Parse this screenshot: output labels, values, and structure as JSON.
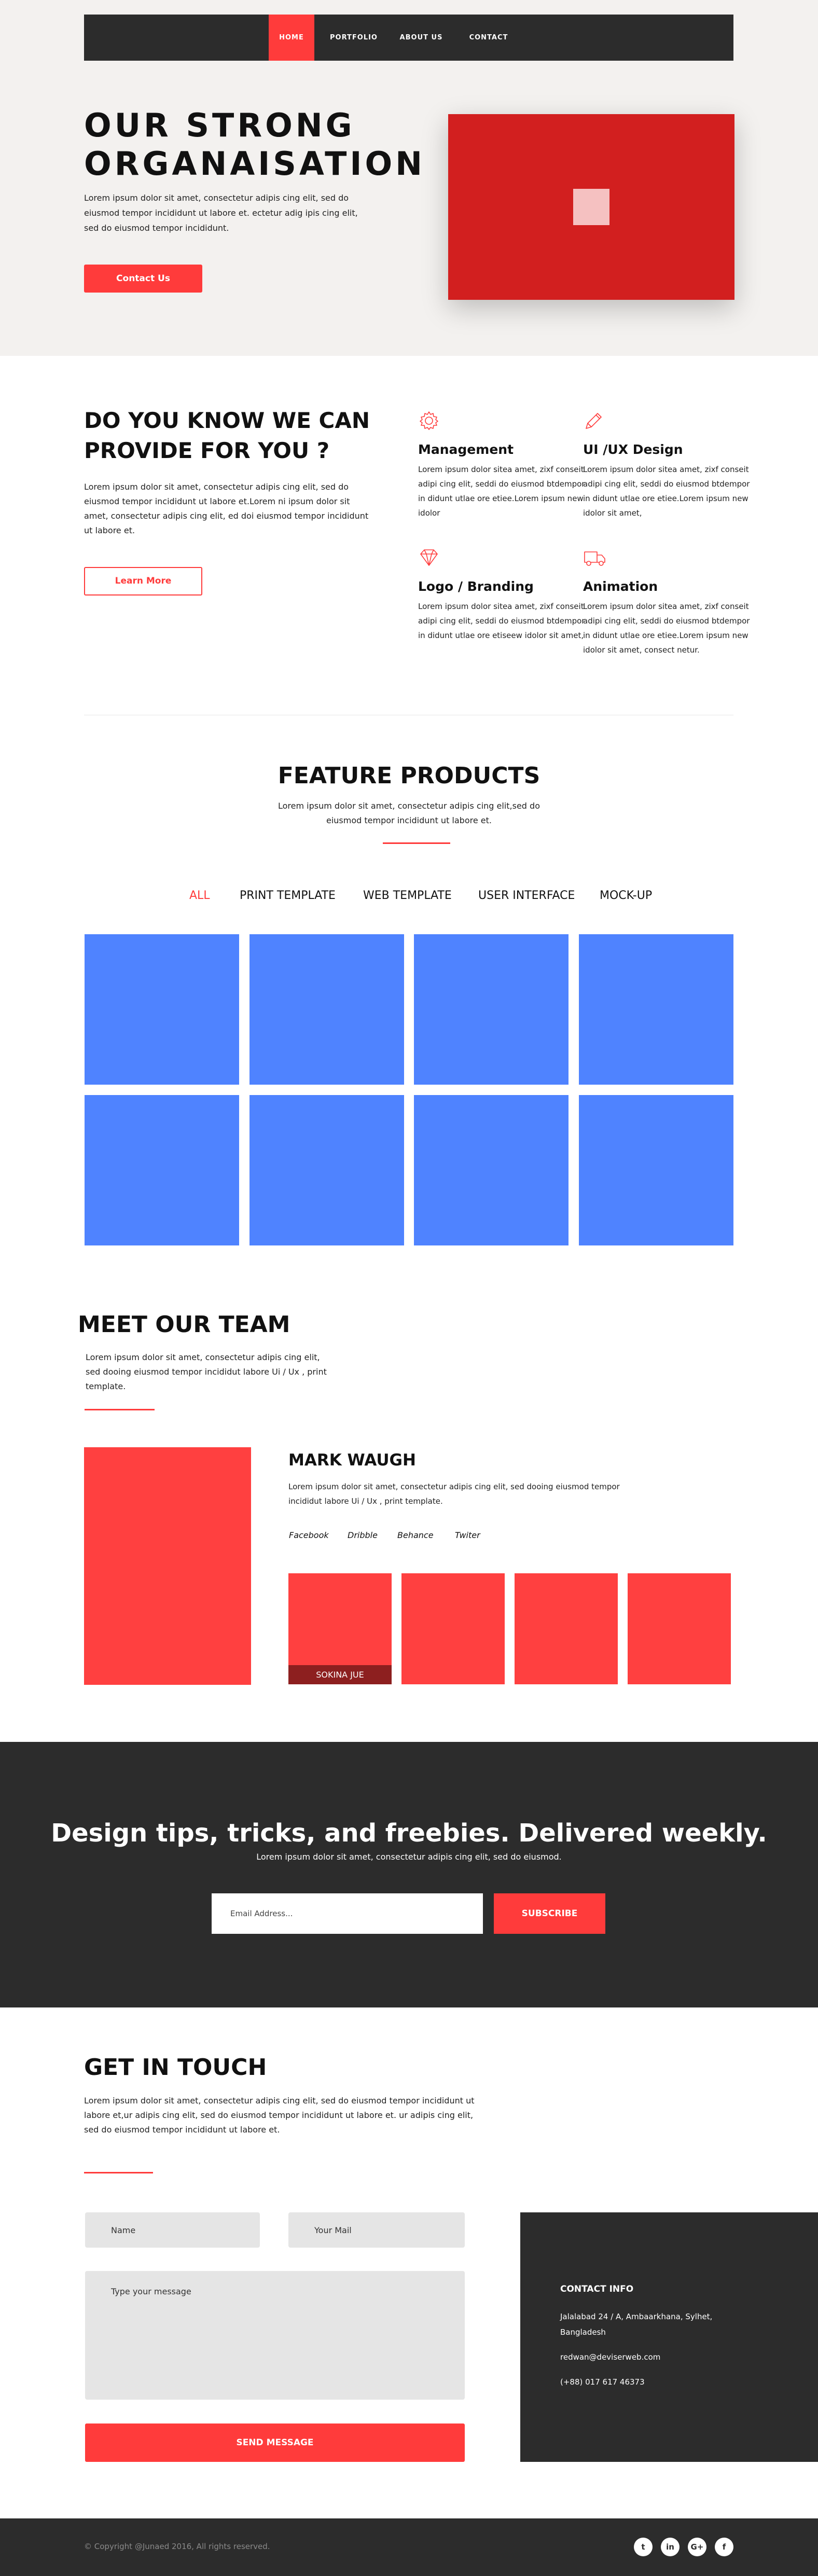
{
  "nav": {
    "items": [
      {
        "label": "HOME",
        "active": true
      },
      {
        "label": "PORTFOLIO",
        "active": false
      },
      {
        "label": "ABOUT US",
        "active": false
      },
      {
        "label": "CONTACT",
        "active": false
      }
    ]
  },
  "hero": {
    "title": "OUR STRONG ORGANAISATION",
    "text": "Lorem ipsum dolor sit amet, consectetur adipis cing elit, sed do eiusmod tempor incididunt  ut labore et. ectetur adig ipis cing elit, sed do eiusmod tempor incididunt.",
    "button": "Contact Us"
  },
  "provide": {
    "title": "DO YOU KNOW WE CAN PROVIDE FOR YOU ?",
    "text": "Lorem ipsum dolor sit amet, consectetur adipis cing elit, sed do eiusmod tempor incididunt ut labore et.Lorem ni ipsum dolor sit amet, consectetur adipis cing elit, ed doi eiusmod tempor incididunt ut labore et.",
    "button": "Learn More",
    "services": [
      {
        "icon": "gear-icon",
        "title": "Management",
        "text": "Lorem ipsum dolor sitea amet, zixf conseit  adipi cing elit, seddi do eiusmod btdempor in didunt utlae ore etiee.Lorem ipsum new idolor"
      },
      {
        "icon": "pencil-icon",
        "title": "UI /UX Design",
        "text": "Lorem ipsum dolor sitea amet, zixf conseit adipi cing elit, seddi do eiusmod btdempor in didunt utlae ore etiee.Lorem ipsum new idolor sit amet,"
      },
      {
        "icon": "diamond-icon",
        "title": "Logo / Branding",
        "text": "Lorem ipsum dolor sitea amet, zixf conseit  adipi cing elit, seddi do eiusmod btdempor in didunt utlae ore etiseew idolor sit amet,"
      },
      {
        "icon": "truck-icon",
        "title": "Animation",
        "text": "Lorem ipsum dolor sitea amet, zixf conseit adipi cing elit, seddi do eiusmod btdempor in didunt utlae ore etiee.Lorem ipsum new idolor sit amet, consect netur."
      }
    ]
  },
  "feature": {
    "title": "FEATURE PRODUCTS",
    "text": "Lorem ipsum dolor sit amet, consectetur adipis cing elit,sed do eiusmod tempor incididunt ut labore et.",
    "filters": [
      "ALL",
      "PRINT TEMPLATE",
      "WEB TEMPLATE",
      "USER INTERFACE",
      "MOCK-UP"
    ],
    "active_filter": "ALL",
    "tile_color": "#4f83ff"
  },
  "team": {
    "title": "MEET OUR TEAM",
    "text": "Lorem ipsum dolor sit amet, consectetur adipis cing elit, sed dooing eiusmod tempor incididut labore Ui / Ux , print template.",
    "member": {
      "name": "MARK WAUGH",
      "text": "Lorem ipsum dolor sit amet, consectetur adipis cing elit, sed dooing eiusmod tempor incididut labore Ui / Ux , print template.",
      "socials": [
        "Facebook",
        "Dribble",
        "Behance",
        "Twiter"
      ]
    },
    "thumb_caption": "SOKINA JUE"
  },
  "newsletter": {
    "title": "Design tips, tricks, and freebies. Delivered weekly.",
    "text": "Lorem ipsum dolor sit amet, consectetur adipis cing elit, sed do eiusmod.",
    "email_placeholder": "Email Address...",
    "button": "SUBSCRIBE"
  },
  "contact": {
    "title": "GET IN TOUCH",
    "text": "Lorem ipsum dolor sit amet, consectetur adipis cing elit, sed do eiusmod tempor incididunt ut labore et,ur adipis cing elit, sed do eiusmod tempor incididunt ut labore et. ur adipis cing elit, sed do eiusmod tempor incididunt ut labore et.",
    "name_placeholder": "Name",
    "mail_placeholder": "Your Mail",
    "message_placeholder": "Type your message",
    "button": "SEND MESSAGE",
    "info": {
      "title": "CONTACT INFO",
      "address": "Jalalabad 24 / A, Ambaarkhana, Sylhet, Bangladesh",
      "email": "redwan@deviserweb.com",
      "phone": "(+88) 017 617 46373"
    }
  },
  "footer": {
    "copyright": "© Copyright @Junaed 2016, All rights reserved.",
    "socials": [
      {
        "icon": "twitter-icon",
        "glyph": "t"
      },
      {
        "icon": "linkedin-icon",
        "glyph": "in"
      },
      {
        "icon": "google-plus-icon",
        "glyph": "G+"
      },
      {
        "icon": "facebook-icon",
        "glyph": "f"
      }
    ]
  },
  "colors": {
    "accent": "#ff3b3b",
    "dark": "#2c2c2c",
    "hero_bg": "#f3f1ef",
    "hero_box": "#d21f1f",
    "tile": "#4f83ff"
  }
}
